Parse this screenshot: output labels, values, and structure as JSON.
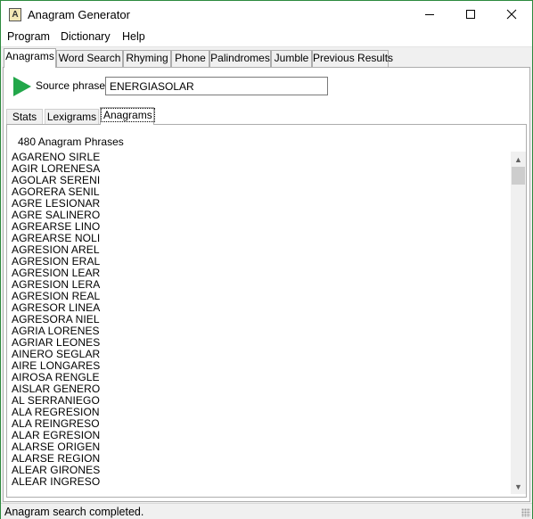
{
  "window": {
    "title": "Anagram Generator",
    "icon_letter": "A"
  },
  "menu": [
    "Program",
    "Dictionary",
    "Help"
  ],
  "tabs": [
    "Anagrams",
    "Word Search",
    "Rhyming",
    "Phone",
    "Palindromes",
    "Jumble",
    "Previous Results"
  ],
  "active_tab": "Anagrams",
  "source": {
    "label": "Source phrase",
    "value": "ENERGIASOLAR"
  },
  "subtabs": [
    "Stats",
    "Lexigrams",
    "Anagrams"
  ],
  "active_subtab": "Anagrams",
  "results": {
    "count_label": "480 Anagram Phrases",
    "items": [
      "AGARENO SIRLE",
      "AGIR LORENESA",
      "AGOLAR SERENI",
      "AGORERA SENIL",
      "AGRE LESIONAR",
      "AGRE SALINERO",
      "AGREARSE LINO",
      "AGREARSE NOLI",
      "AGRESION AREL",
      "AGRESION ERAL",
      "AGRESION LEAR",
      "AGRESION LERA",
      "AGRESION REAL",
      "AGRESOR LINEA",
      "AGRESORA NIEL",
      "AGRIA LORENES",
      "AGRIAR LEONES",
      "AINERO SEGLAR",
      "AIRE LONGARES",
      "AIROSA RENGLE",
      "AISLAR GENERO",
      "AL SERRANIEGO",
      "ALA REGRESION",
      "ALA REINGRESO",
      "ALAR EGRESION",
      "ALARSE ORIGEN",
      "ALARSE REGION",
      "ALEAR GIRONES",
      "ALEAR INGRESO"
    ]
  },
  "status": "Anagram search completed.",
  "colors": {
    "window_border": "#2d8a3e",
    "play_green": "#22a74a"
  },
  "icons": {
    "go": "green-play-triangle",
    "minimize": "minimize-icon",
    "maximize": "maximize-icon",
    "close": "close-icon"
  }
}
